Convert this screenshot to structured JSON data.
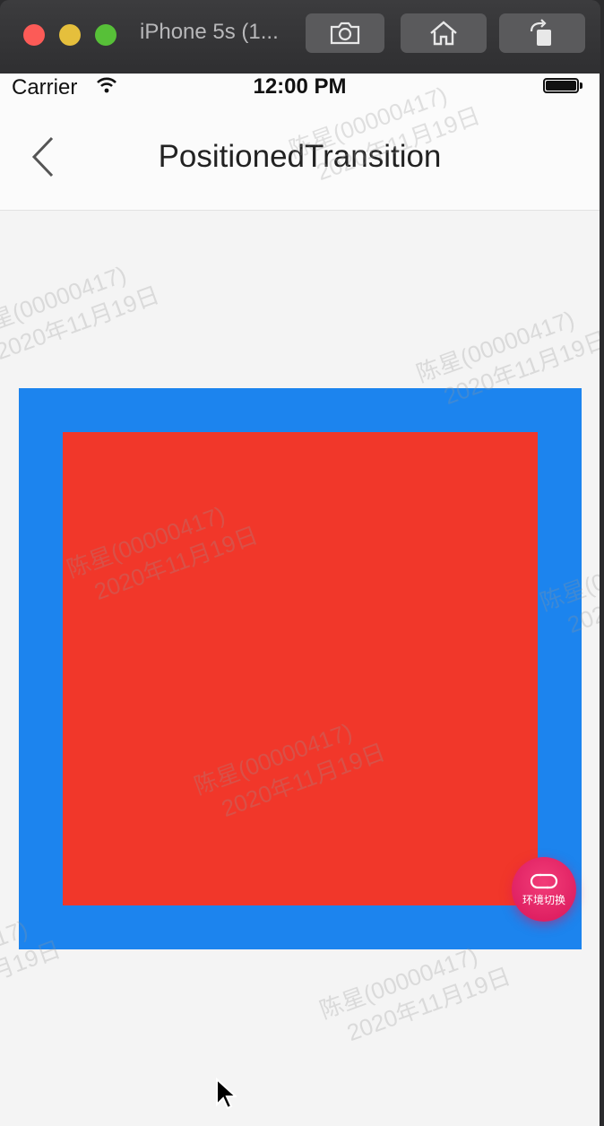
{
  "window": {
    "title": "iPhone 5s (1...",
    "buttons": [
      "screenshot",
      "home",
      "rotate"
    ]
  },
  "status_bar": {
    "carrier": "Carrier",
    "time": "12:00 PM",
    "icons": [
      "wifi-icon",
      "battery-icon"
    ]
  },
  "nav": {
    "title": "PositionedTransition",
    "back_icon": "chevron-left-icon"
  },
  "demo": {
    "outer_color": "#1c84ee",
    "inner_color": "#f1372a"
  },
  "env_switch": {
    "label": "环境切换",
    "icon": "switch-icon"
  },
  "watermark": {
    "line1": "陈星(00000417)",
    "line2": "2020年11月19日"
  },
  "colors": {
    "env_switch": "#e3206a",
    "background": "#f4f4f4"
  }
}
